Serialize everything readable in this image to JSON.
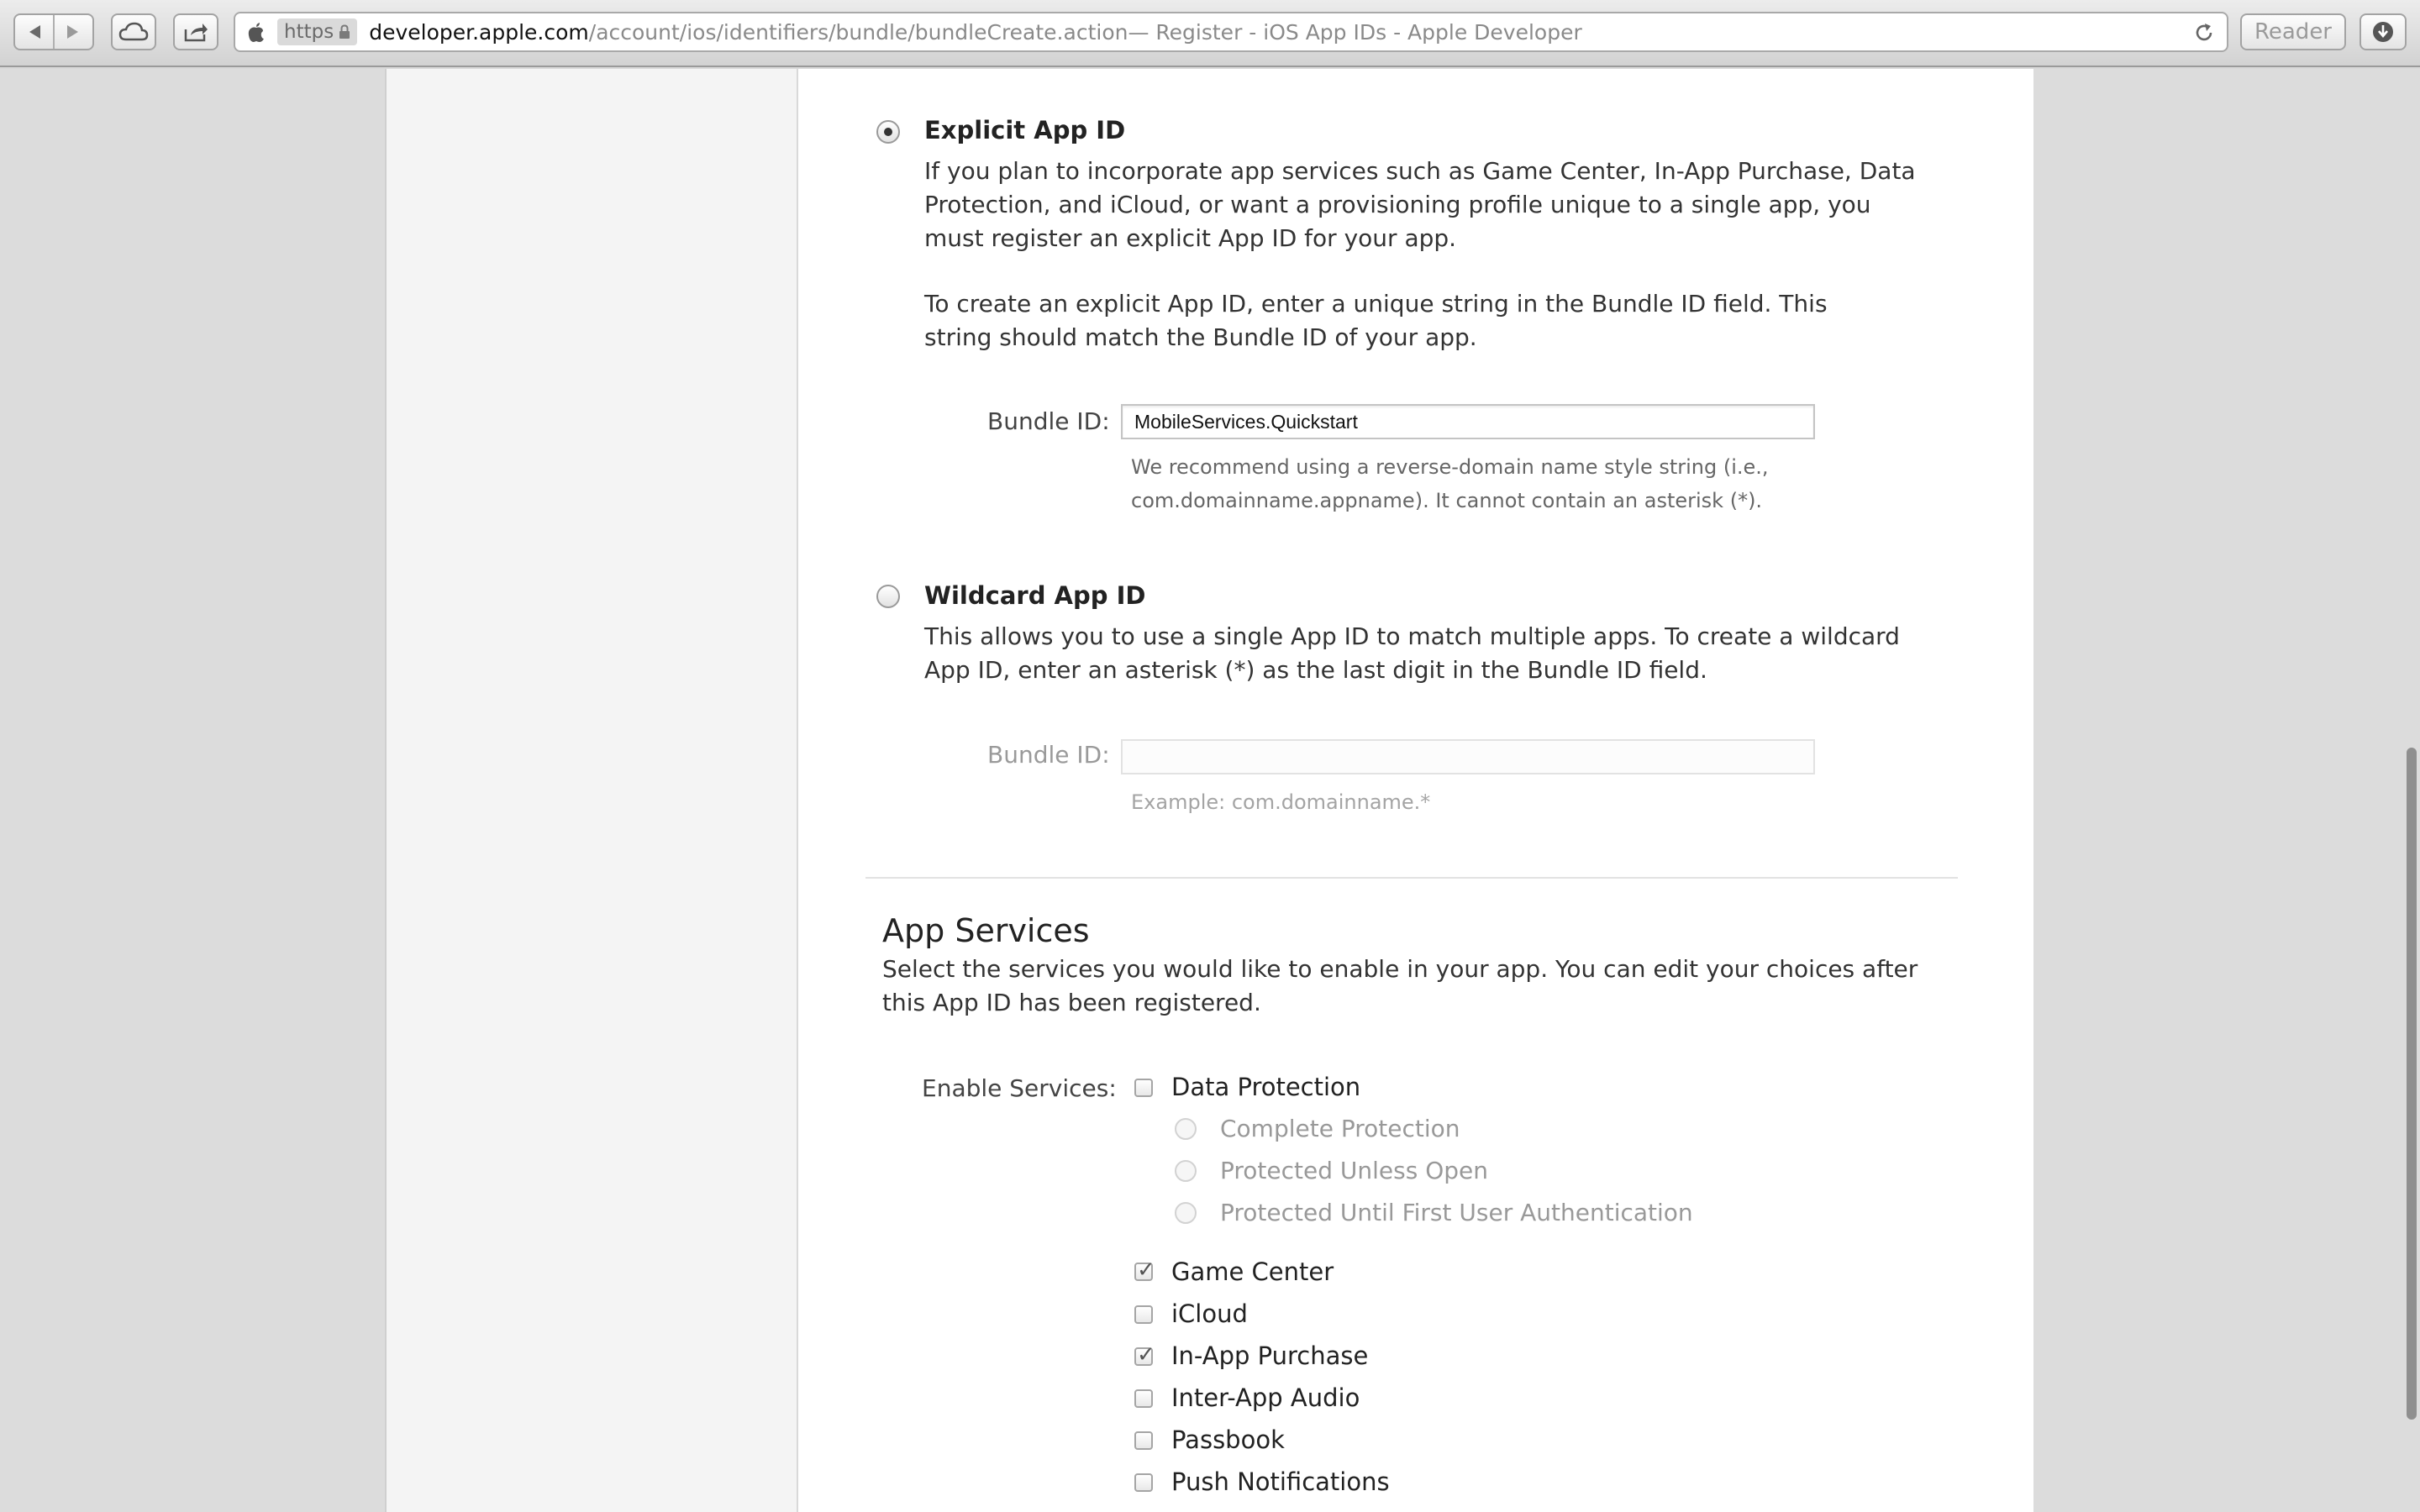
{
  "browser": {
    "url_scheme": "https",
    "url_host": "developer.apple.com",
    "url_path": "/account/ios/identifiers/bundle/bundleCreate.action",
    "url_title": " — Register - iOS App IDs - Apple Developer",
    "reader_label": "Reader"
  },
  "explicit": {
    "title": "Explicit App ID",
    "para1": "If you plan to incorporate app services such as Game Center, In-App Purchase, Data Protection, and iCloud, or want a provisioning profile unique to a single app, you must register an explicit App ID for your app.",
    "para2": "To create an explicit App ID, enter a unique string in the Bundle ID field. This string should match the Bundle ID of your app.",
    "bundle_label": "Bundle ID:",
    "bundle_value": "MobileServices.Quickstart",
    "hint": "We recommend using a reverse-domain name style string (i.e., com.domainname.appname). It cannot contain an asterisk (*)."
  },
  "wildcard": {
    "title": "Wildcard App ID",
    "para": "This allows you to use a single App ID to match multiple apps. To create a wildcard App ID, enter an asterisk (*) as the last digit in the Bundle ID field.",
    "bundle_label": "Bundle ID:",
    "bundle_value": "",
    "hint": "Example: com.domainname.*"
  },
  "services": {
    "title": "App Services",
    "description": "Select the services you would like to enable in your app. You can edit your choices after this App ID has been registered.",
    "enable_label": "Enable Services:",
    "data_protection": "Data Protection",
    "protection_options": [
      "Complete Protection",
      "Protected Unless Open",
      "Protected Until First User Authentication"
    ],
    "items": [
      {
        "label": "Game Center",
        "checked": true
      },
      {
        "label": "iCloud",
        "checked": false
      },
      {
        "label": "In-App Purchase",
        "checked": true
      },
      {
        "label": "Inter-App Audio",
        "checked": false
      },
      {
        "label": "Passbook",
        "checked": false
      },
      {
        "label": "Push Notifications",
        "checked": false
      }
    ]
  },
  "colors": {
    "page_background": "#dcdcdc",
    "content_background": "#ffffff",
    "text": "#333333"
  }
}
